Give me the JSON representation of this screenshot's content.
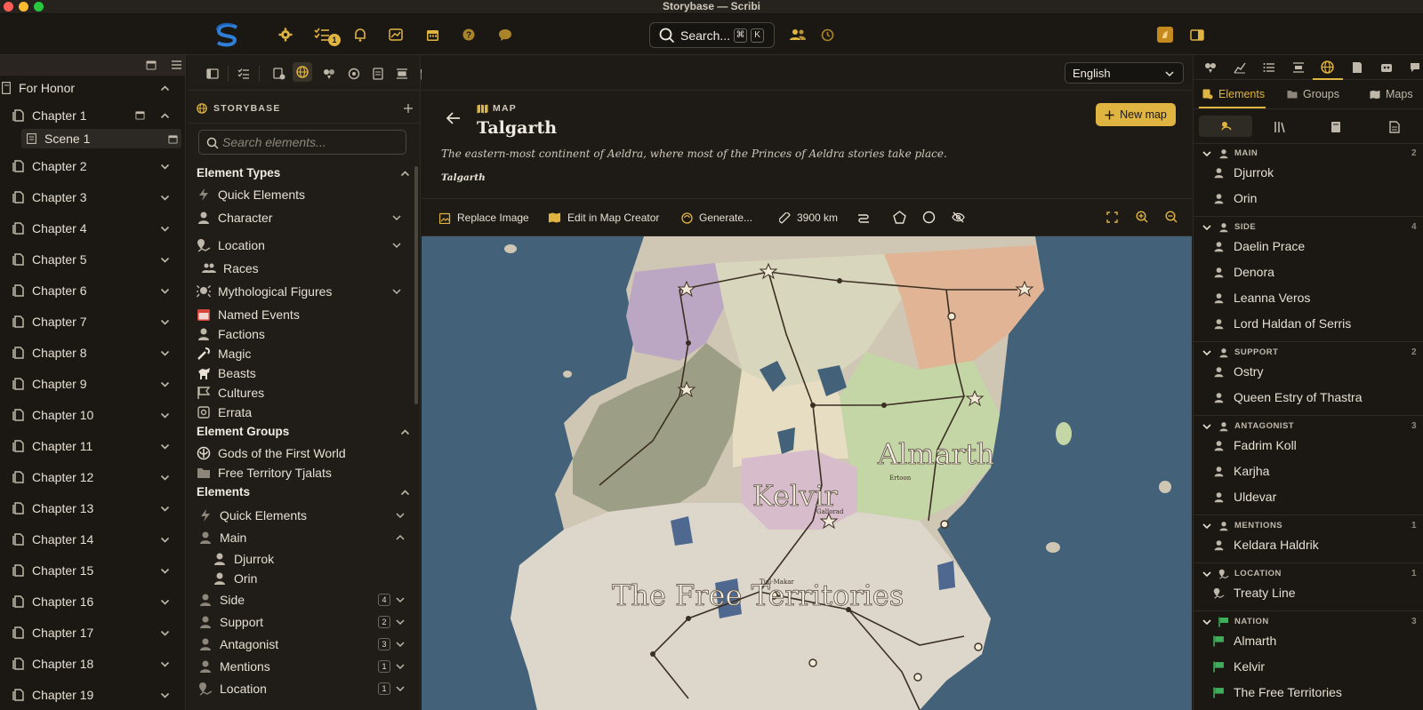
{
  "window": {
    "title": "Storybase — Scribi"
  },
  "toolbar": {
    "search_label": "Search...",
    "shortcut_cmd": "⌘",
    "shortcut_key": "K",
    "notification_count": "1"
  },
  "left": {
    "project": "For Honor",
    "chapter1": "Chapter 1",
    "scene1": "Scene 1",
    "chapters": [
      "Chapter 2",
      "Chapter 3",
      "Chapter 4",
      "Chapter 5",
      "Chapter 6",
      "Chapter 7",
      "Chapter 8",
      "Chapter 9",
      "Chapter 10",
      "Chapter 11",
      "Chapter 12",
      "Chapter 13",
      "Chapter 14",
      "Chapter 15",
      "Chapter 16",
      "Chapter 17",
      "Chapter 18",
      "Chapter 19"
    ]
  },
  "storybase": {
    "title": "STORYBASE",
    "search_placeholder": "Search elements...",
    "sec_types": "Element Types",
    "types": {
      "quick": "Quick Elements",
      "character": "Character",
      "location": "Location",
      "races": "Races",
      "myth": "Mythological Figures",
      "events": "Named Events",
      "factions": "Factions",
      "magic": "Magic",
      "beasts": "Beasts",
      "cultures": "Cultures",
      "errata": "Errata"
    },
    "sec_groups": "Element Groups",
    "groups": {
      "gods": "Gods of the First World",
      "free": "Free Territory Tjalats"
    },
    "sec_elements": "Elements",
    "elements": {
      "quick": "Quick Elements",
      "main": "Main",
      "djurrok": "Djurrok",
      "orin": "Orin",
      "side": "Side",
      "side_count": "4",
      "support": "Support",
      "support_count": "2",
      "antagonist": "Antagonist",
      "antagonist_count": "3",
      "mentions": "Mentions",
      "mentions_count": "1",
      "location": "Location",
      "location_count": "1"
    }
  },
  "main": {
    "language": "English",
    "kind": "MAP",
    "title": "Talgarth",
    "new_map": "New map",
    "description": "The eastern-most continent of Aeldra, where most of the Princes of Aeldra stories take place.",
    "tag": "Talgarth",
    "tools": {
      "replace": "Replace Image",
      "edit": "Edit in Map Creator",
      "generate": "Generate...",
      "distance": "3900 km"
    },
    "map_labels": {
      "almarth": "Almarth",
      "kelvir": "Kelvir",
      "free": "The Free Territories",
      "ertoon": "Ertoon",
      "gallorad": "Gallorad",
      "tjal": "Tjal-Makar"
    }
  },
  "right": {
    "tabs": {
      "elements": "Elements",
      "groups": "Groups",
      "maps": "Maps"
    },
    "groups": [
      {
        "name": "MAIN",
        "count": "2",
        "items": [
          "Djurrok",
          "Orin"
        ]
      },
      {
        "name": "SIDE",
        "count": "4",
        "items": [
          "Daelin Prace",
          "Denora",
          "Leanna Veros",
          "Lord Haldan of Serris"
        ]
      },
      {
        "name": "SUPPORT",
        "count": "2",
        "items": [
          "Ostry",
          "Queen Estry of Thastra"
        ]
      },
      {
        "name": "ANTAGONIST",
        "count": "3",
        "items": [
          "Fadrim Koll",
          "Karjha",
          "Uldevar"
        ]
      },
      {
        "name": "MENTIONS",
        "count": "1",
        "items": [
          "Keldara Haldrik"
        ]
      },
      {
        "name": "LOCATION",
        "count": "1",
        "items": [
          "Treaty Line"
        ]
      },
      {
        "name": "NATION",
        "count": "3",
        "items": [
          "Almarth",
          "Kelvir",
          "The Free Territories"
        ]
      }
    ]
  },
  "colors": {
    "accent": "#e0b440",
    "background": "#1d1a16",
    "water": "#43627a"
  }
}
